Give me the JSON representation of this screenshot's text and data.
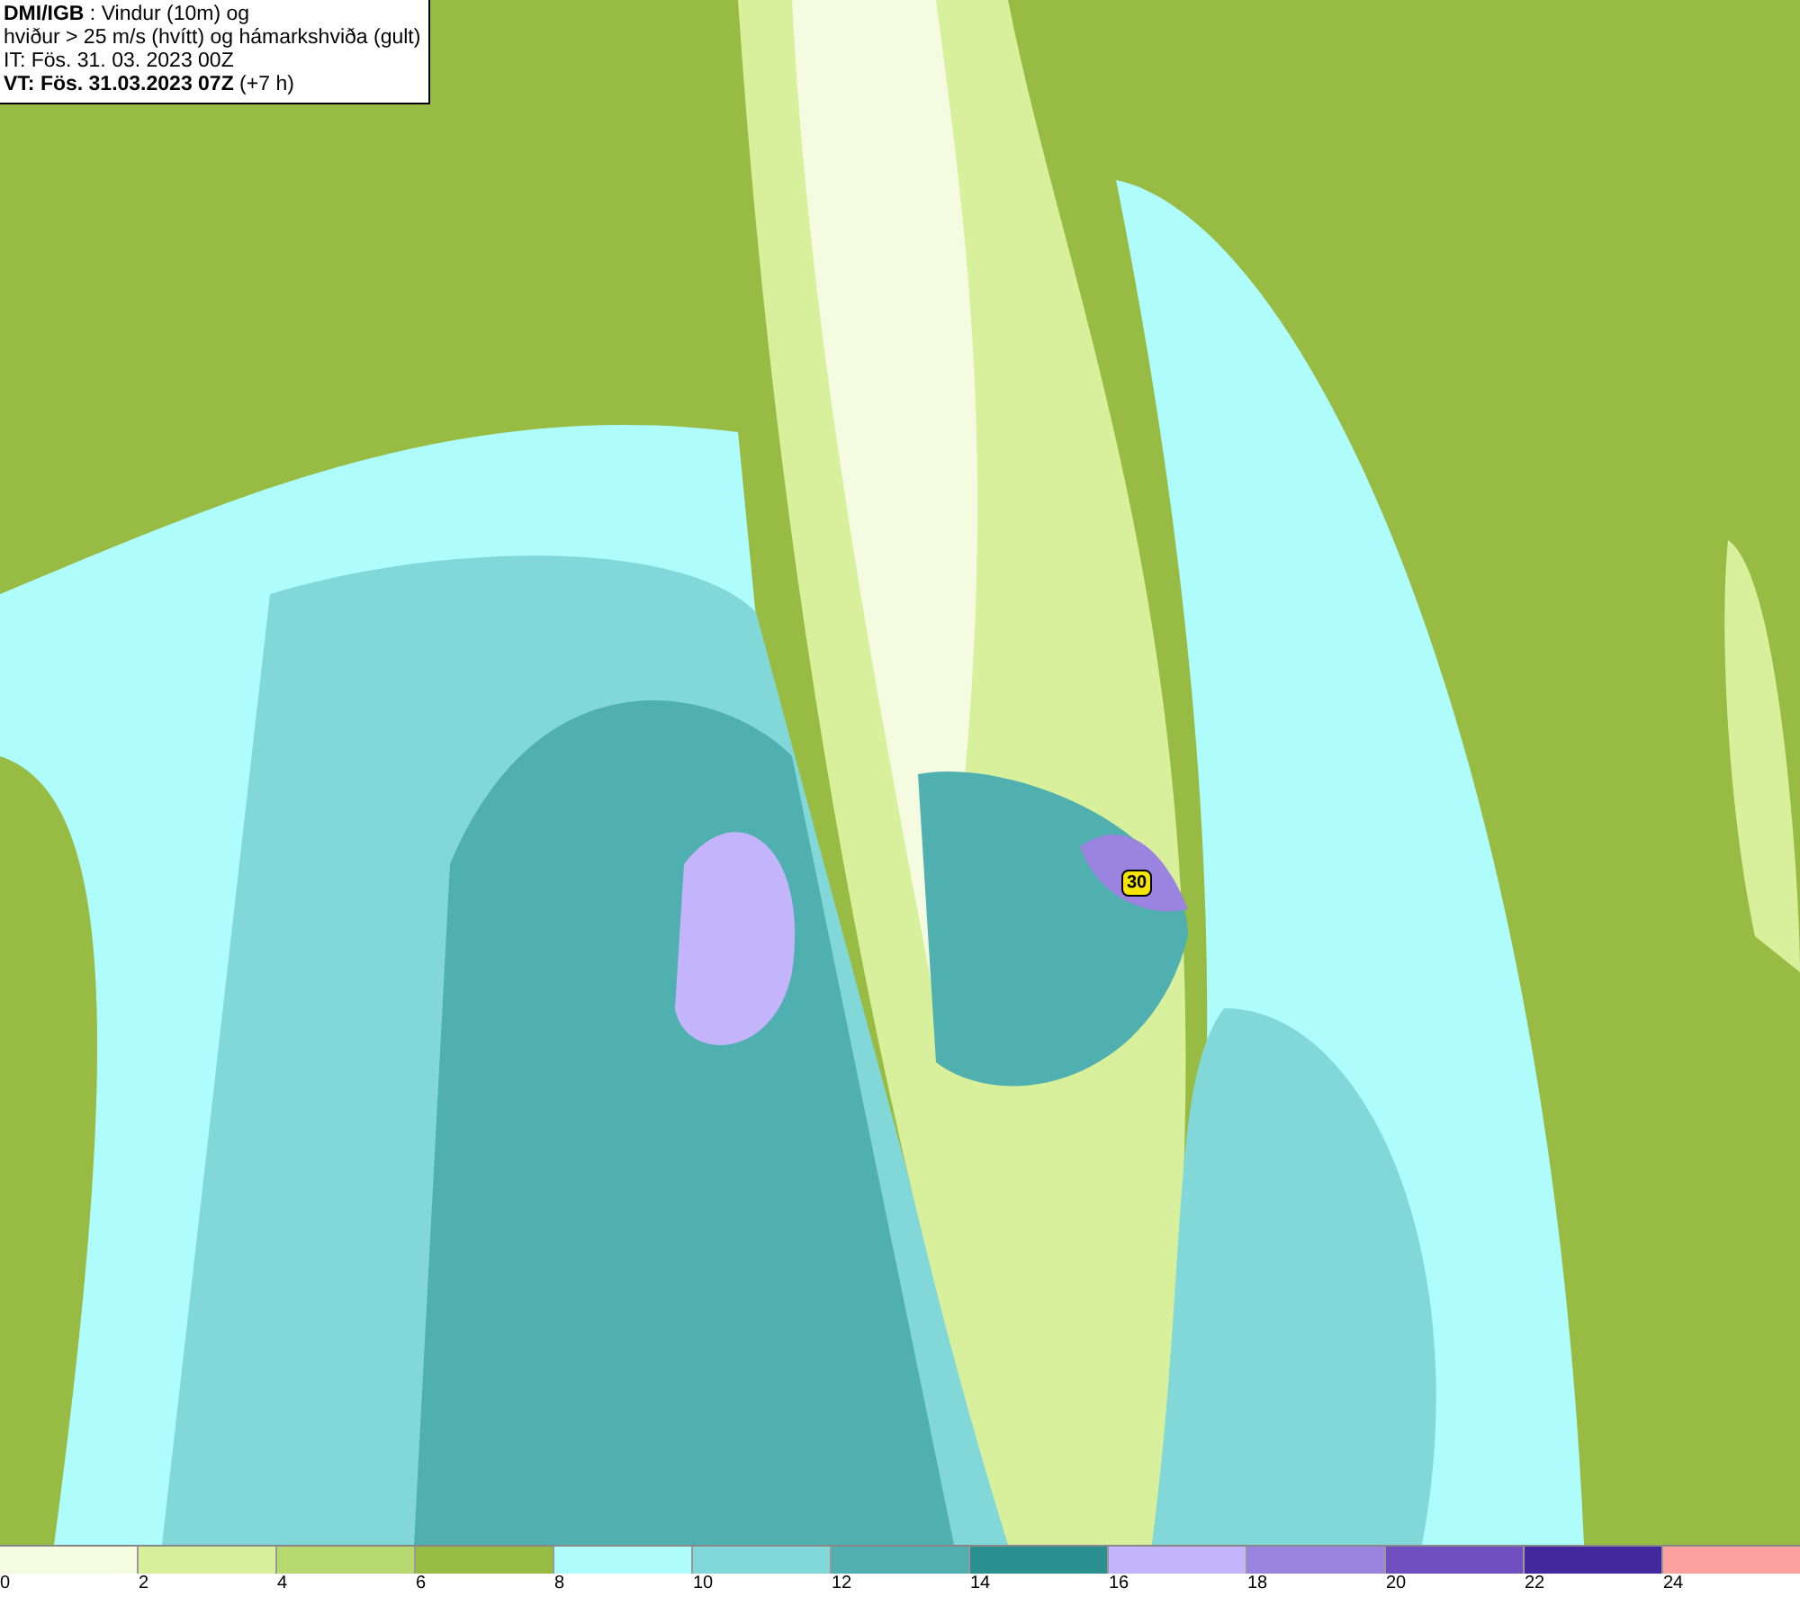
{
  "title_box": {
    "lines": [
      "**DMI/IGB** : Vindur (10m) og",
      "hviður > 25 m/s (hvítt) og hámarkshviða (gult)",
      "IT: Fös. 31. 03. 2023 00Z",
      "**VT: Fös. 31.03.2023 07Z** (+7 h)"
    ]
  },
  "map": {
    "gust_label": "30"
  },
  "legend": {
    "bins": [
      {
        "color": "#f4fbe0"
      },
      {
        "color": "#d8f09c"
      },
      {
        "color": "#b8d870"
      },
      {
        "color": "#98bb44"
      },
      {
        "color": "#aefcfc"
      },
      {
        "color": "#82d8d8"
      },
      {
        "color": "#50b0b0"
      },
      {
        "color": "#2a9090"
      },
      {
        "color": "#c4b4fc"
      },
      {
        "color": "#9a84e0"
      },
      {
        "color": "#7050c0"
      },
      {
        "color": "#4428a0"
      },
      {
        "color": "#fca0a0"
      }
    ],
    "ticks": [
      "0",
      "2",
      "4",
      "6",
      "8",
      "10",
      "12",
      "14",
      "16",
      "18",
      "20",
      "22",
      "24"
    ]
  }
}
